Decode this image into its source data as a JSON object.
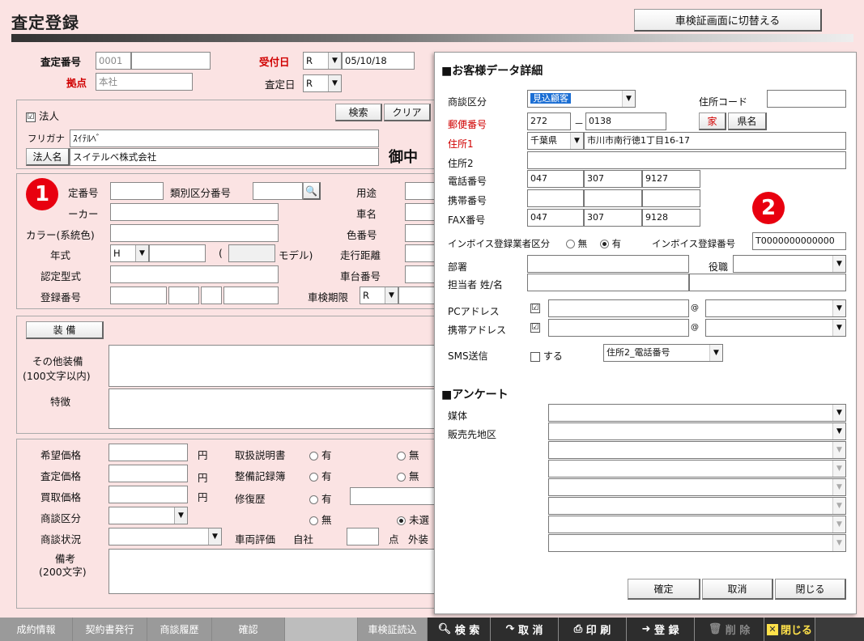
{
  "title": "査定登録",
  "switch_button": "車検証画面に切替える",
  "header": {
    "assess_no_label": "査定番号",
    "assess_no_value": "0001",
    "branch_label": "拠点",
    "branch_value": "本社",
    "received_label": "受付日",
    "era1": "R",
    "received_date": "05/10/18",
    "assess_date_label": "査定日",
    "era2": "R"
  },
  "customer": {
    "corp_label": "法人",
    "corp_checked": "☑",
    "search_btn": "検索",
    "clear_btn": "クリア",
    "kana_label": "フリガナ",
    "kana_value": "ｽｲﾃﾙﾍﾞ",
    "name_btn": "法人名",
    "name_value": "スイテルベ株式会社",
    "onchu": "御中"
  },
  "vehicle": {
    "type_no_label": "定番号",
    "class_no_label": "類別区分番号",
    "use_label": "用途",
    "maker_label": "ーカー",
    "car_name_label": "車名",
    "color_label": "カラー(系統色)",
    "color_no_label": "色番号",
    "year_label": "年式",
    "year_era": "H",
    "paren_open": "(",
    "model_label": "モデル)",
    "mileage_label": "走行距離",
    "cert_type_label": "認定型式",
    "chassis_label": "車台番号",
    "reg_no_label": "登録番号",
    "inspection_label": "車検期限",
    "inspection_era": "R"
  },
  "equipment": {
    "equip_btn": "装 備",
    "other_label": "その他装備",
    "other_sub": "(100文字以内)",
    "feature_label": "特徴"
  },
  "pricing": {
    "desired_label": "希望価格",
    "assessed_label": "査定価格",
    "purchase_label": "買取価格",
    "yen": "円",
    "manual_label": "取扱説明書",
    "maintenance_label": "整備記録簿",
    "repair_label": "修復歴",
    "yes": "有",
    "no": "無",
    "unconfirmed": "未選",
    "deal_type_label": "商談区分",
    "deal_status_label": "商談状況",
    "eval_label": "車両評価",
    "own_company": "自社",
    "points": "点",
    "exterior": "外装",
    "remarks_label": "備考",
    "remarks_sub": "(200文字)"
  },
  "modal": {
    "heading": "■お客様データ詳細",
    "deal_type_label": "商談区分",
    "deal_type_value": "見込顧客",
    "address_code_label": "住所コード",
    "postal_label": "郵便番号",
    "postal1": "272",
    "dash": "－",
    "postal2": "0138",
    "home_btn": "家",
    "pref_btn": "県名",
    "addr1_label": "住所1",
    "pref_value": "千葉県",
    "addr1_value": "市川市南行徳1丁目16-17",
    "addr2_label": "住所2",
    "tel_label": "電話番号",
    "tel": [
      "047",
      "307",
      "9127"
    ],
    "mobile_label": "携帯番号",
    "fax_label": "FAX番号",
    "fax": [
      "047",
      "307",
      "9128"
    ],
    "invoice_type_label": "インボイス登録業者区分",
    "invoice_no": "無",
    "invoice_yes": "有",
    "invoice_no_label": "インボイス登録番号",
    "invoice_no_value": "T0000000000000",
    "dept_label": "部署",
    "title_label": "役職",
    "contact_label": "担当者 姓/名",
    "pc_addr_label": "PCアドレス",
    "mobile_addr_label": "携帯アドレス",
    "check": "☑",
    "at": "@",
    "sms_label": "SMS送信",
    "sms_do": "する",
    "sms_target": "住所2_電話番号",
    "survey_heading": "■アンケート",
    "media_label": "媒体",
    "sales_area_label": "販売先地区",
    "confirm_btn": "確定",
    "cancel_btn": "取消",
    "close_btn": "閉じる"
  },
  "footer": {
    "b1": "成約情報",
    "b2": "契約書発行",
    "b3": "商談履歴",
    "b4": "確認",
    "b5": "",
    "b6": "車検証読込",
    "b7": "検 索",
    "b8": "取 消",
    "b9": "印 刷",
    "b10": "登 録",
    "b11": "削 除",
    "b12": "閉じる"
  },
  "badges": {
    "one": "1",
    "two": "2"
  },
  "colors": {
    "background": "#fbe3e3",
    "accent_red": "#e8000f",
    "selection_blue": "#1c6fd4",
    "footer": "#3a3a3a",
    "close_yellow": "#ffe14a"
  }
}
